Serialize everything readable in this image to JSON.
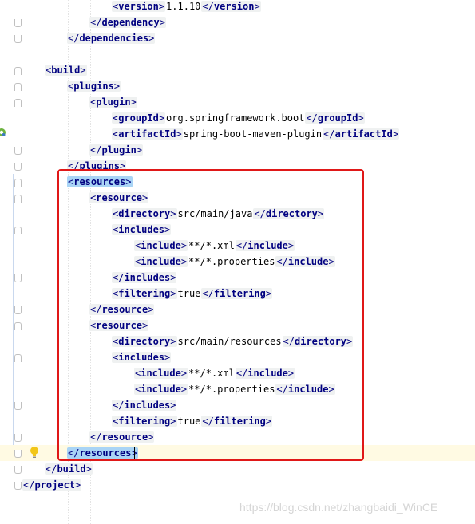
{
  "lines": [
    {
      "open": "version",
      "text": "1.1.10",
      "close": "version"
    },
    {
      "close_only": "dependency"
    },
    {
      "close_only": "dependencies"
    },
    {},
    {
      "open": "build"
    },
    {
      "open": "plugins"
    },
    {
      "open": "plugin"
    },
    {
      "open": "groupId",
      "text": "org.springframework.boot",
      "close": "groupId"
    },
    {
      "open": "artifactId",
      "text": "spring-boot-maven-plugin",
      "close": "artifactId"
    },
    {
      "close_only": "plugin"
    },
    {
      "close_only": "plugins"
    },
    {
      "open": "resources"
    },
    {
      "open": "resource"
    },
    {
      "open": "directory",
      "text": "src/main/java",
      "close": "directory"
    },
    {
      "open": "includes"
    },
    {
      "open": "include",
      "text": "**/*.xml",
      "close": "include"
    },
    {
      "open": "include",
      "text": "**/*.properties",
      "close": "include"
    },
    {
      "close_only": "includes"
    },
    {
      "open": "filtering",
      "text": "true",
      "close": "filtering"
    },
    {
      "close_only": "resource"
    },
    {
      "open": "resource"
    },
    {
      "open": "directory",
      "text": "src/main/resources",
      "close": "directory"
    },
    {
      "open": "includes"
    },
    {
      "open": "include",
      "text": "**/*.xml",
      "close": "include"
    },
    {
      "open": "include",
      "text": "**/*.properties",
      "close": "include"
    },
    {
      "close_only": "includes"
    },
    {
      "open": "filtering",
      "text": "true",
      "close": "filtering"
    },
    {
      "close_only": "resource"
    },
    {
      "close_only": "resources"
    },
    {
      "close_only": "build"
    },
    {
      "close_only": "project"
    }
  ],
  "watermark": "https://blog.csdn.net/zhangbaidi_WinCE",
  "icons": {
    "gutter_left": "spring-gear-icon",
    "intention": "lightbulb-icon"
  },
  "colors": {
    "tag_name": "#000080",
    "tag_bg": "#eff1f1",
    "match_highlight": "#a9d4f5",
    "annotation_box": "#e01818"
  }
}
